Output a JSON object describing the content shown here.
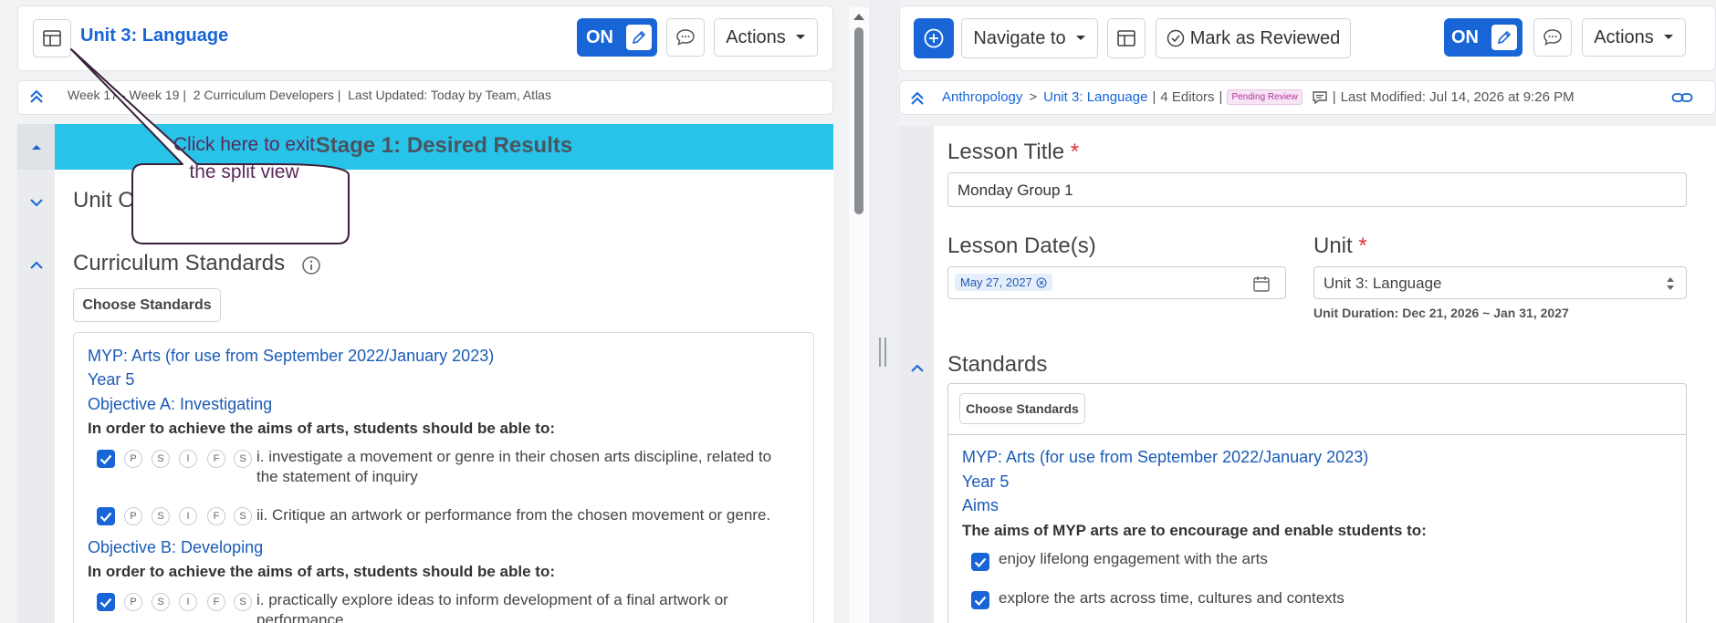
{
  "left": {
    "unit_title": "Unit 3: Language",
    "on_label": "ON",
    "actions_label": "Actions",
    "meta": {
      "weeks": "Week 17 - Week 19",
      "developers": "2 Curriculum Developers",
      "updated": "Last Updated: Today by Team, Atlas"
    },
    "stage_title": "Stage 1: Desired Results",
    "unit_overview": "Unit Overview",
    "curriculum_standards": "Curriculum Standards",
    "choose_standards": "Choose Standards",
    "standards": {
      "framework": "MYP: Arts (for use from September 2022/January 2023)",
      "year": "Year 5",
      "objective_a": "Objective A: Investigating",
      "aims_a": "In order to achieve the aims of arts, students should be able to:",
      "item_a1_line1": "i. investigate a movement or genre in their chosen arts discipline, related to",
      "item_a1_line2": "the statement of inquiry",
      "item_a2": "ii. Critique an artwork or performance from the chosen movement or genre.",
      "objective_b": "Objective B: Developing",
      "aims_b": "In order to achieve the aims of arts, students should be able to:",
      "item_b1_line1": "i. practically explore ideas to inform development of a final artwork or",
      "item_b1_line2": "performance"
    },
    "pills": [
      "P",
      "S",
      "I",
      "F",
      "S"
    ]
  },
  "tooltip": {
    "line1": "Click here to exit",
    "line2": "the split view"
  },
  "right": {
    "navigate_label": "Navigate to",
    "mark_reviewed": "Mark as Reviewed",
    "on_label": "ON",
    "actions_label": "Actions",
    "breadcrumb": {
      "subject": "Anthropology",
      "separator": ">",
      "unit": "Unit 3: Language",
      "editors": "4 Editors",
      "status_badge": "Pending Review",
      "modified": "Last Modified: Jul 14, 2026 at 9:26 PM"
    },
    "lesson_title_label": "Lesson Title",
    "required_mark": "*",
    "lesson_title_value": "Monday Group 1",
    "lesson_dates_label": "Lesson Date(s)",
    "date_chip": "May 27, 2027",
    "unit_label": "Unit",
    "unit_value": "Unit 3: Language",
    "unit_duration": "Unit Duration: Dec 21, 2026 ~ Jan 31, 2027",
    "standards_label": "Standards",
    "choose_standards": "Choose Standards",
    "standards": {
      "framework": "MYP: Arts (for use from September 2022/January 2023)",
      "year": "Year 5",
      "aims": "Aims",
      "aims_intro": "The aims of MYP arts are to encourage and enable students to:",
      "aim1": "enjoy lifelong engagement with the arts",
      "aim2": "explore the arts across time, cultures and contexts"
    }
  },
  "colors": {
    "accent": "#1765d6",
    "stage_bar": "#27c3e8",
    "badge_text": "#b0359f",
    "badge_bg": "#f7e4f4"
  }
}
